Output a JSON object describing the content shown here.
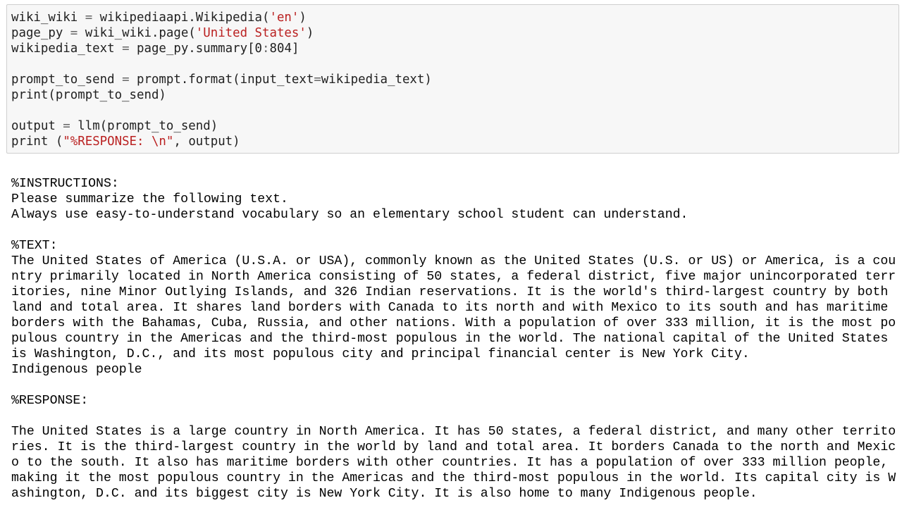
{
  "code_cell": {
    "lines": [
      [
        {
          "t": "wiki_wiki ",
          "c": ""
        },
        {
          "t": "=",
          "c": "op"
        },
        {
          "t": " wikipediaapi.Wikipedia(",
          "c": ""
        },
        {
          "t": "'en'",
          "c": "str"
        },
        {
          "t": ")",
          "c": ""
        }
      ],
      [
        {
          "t": "page_py ",
          "c": ""
        },
        {
          "t": "=",
          "c": "op"
        },
        {
          "t": " wiki_wiki.page(",
          "c": ""
        },
        {
          "t": "'United States'",
          "c": "str"
        },
        {
          "t": ")",
          "c": ""
        }
      ],
      [
        {
          "t": "wikipedia_text ",
          "c": ""
        },
        {
          "t": "=",
          "c": "op"
        },
        {
          "t": " page_py.summary[",
          "c": ""
        },
        {
          "t": "0",
          "c": ""
        },
        {
          "t": ":",
          "c": "op"
        },
        {
          "t": "804",
          "c": ""
        },
        {
          "t": "]",
          "c": ""
        }
      ],
      [],
      [
        {
          "t": "prompt_to_send ",
          "c": ""
        },
        {
          "t": "=",
          "c": "op"
        },
        {
          "t": " prompt.format(input_text",
          "c": ""
        },
        {
          "t": "=",
          "c": "op"
        },
        {
          "t": "wikipedia_text)",
          "c": ""
        }
      ],
      [
        {
          "t": "print",
          "c": ""
        },
        {
          "t": "(prompt_to_send)",
          "c": ""
        }
      ],
      [],
      [
        {
          "t": "output ",
          "c": ""
        },
        {
          "t": "=",
          "c": "op"
        },
        {
          "t": " llm(prompt_to_send)",
          "c": ""
        }
      ],
      [
        {
          "t": "print",
          "c": ""
        },
        {
          "t": " (",
          "c": ""
        },
        {
          "t": "\"%RESPONSE: \\n\"",
          "c": "str"
        },
        {
          "t": ", output)",
          "c": ""
        }
      ]
    ]
  },
  "output": {
    "lines": [
      "%INSTRUCTIONS:",
      "Please summarize the following text.",
      "Always use easy-to-understand vocabulary so an elementary school student can understand.",
      "",
      "%TEXT:",
      "The United States of America (U.S.A. or USA), commonly known as the United States (U.S. or US) or America, is a cou",
      "ntry primarily located in North America consisting of 50 states, a federal district, five major unincorporated terr",
      "itories, nine Minor Outlying Islands, and 326 Indian reservations. It is the world's third-largest country by both",
      "land and total area. It shares land borders with Canada to its north and with Mexico to its south and has maritime",
      "borders with the Bahamas, Cuba, Russia, and other nations. With a population of over 333 million, it is the most po",
      "pulous country in the Americas and the third-most populous in the world. The national capital of the United States",
      "is Washington, D.C., and its most populous city and principal financial center is New York City.",
      "Indigenous people",
      "",
      "%RESPONSE:",
      "",
      "The United States is a large country in North America. It has 50 states, a federal district, and many other territo",
      "ries. It is the third-largest country in the world by land and total area. It borders Canada to the north and Mexic",
      "o to the south. It also has maritime borders with other countries. It has a population of over 333 million people,",
      "making it the most populous country in the Americas and the third-most populous in the world. Its capital city is W",
      "ashington, D.C. and its biggest city is New York City. It is also home to many Indigenous people."
    ]
  }
}
